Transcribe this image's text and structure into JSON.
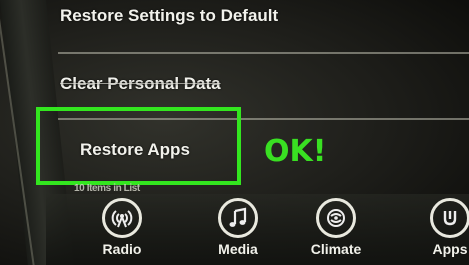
{
  "menu": {
    "items": [
      {
        "label": "Restore Settings to Default"
      },
      {
        "label": "Clear Personal Data"
      },
      {
        "label": "Restore Apps"
      }
    ],
    "items_count": "10 Items in List"
  },
  "annotation": {
    "ok_text": "OK!",
    "highlight_color": "#33e61f"
  },
  "dock": {
    "buttons": [
      {
        "label": "Radio",
        "icon": "radio-icon"
      },
      {
        "label": "Media",
        "icon": "music-note-icon"
      },
      {
        "label": "Climate",
        "icon": "climate-icon"
      },
      {
        "label": "Apps",
        "icon": "apps-icon"
      }
    ]
  }
}
